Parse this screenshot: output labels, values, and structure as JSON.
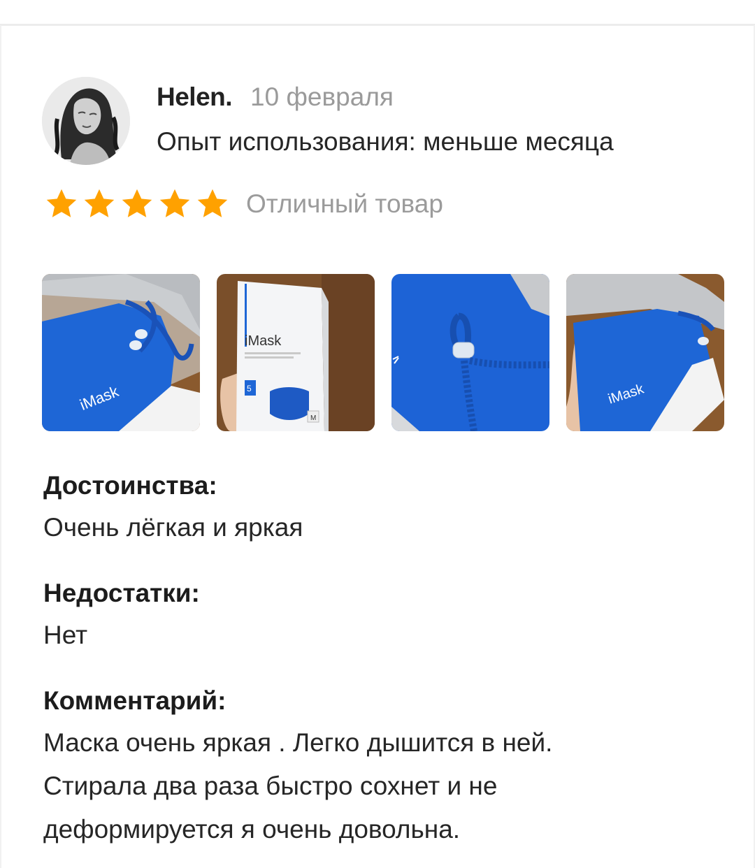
{
  "review": {
    "author": "Helen.",
    "date": "10 февраля",
    "usage": "Опыт использования: меньше месяца",
    "rating": 5,
    "rating_max": 5,
    "rating_label": "Отличный товар",
    "star_color": "#FFA100",
    "photos": [
      {
        "brand_text": "iMask"
      },
      {
        "brand_text": "iMask",
        "box_number": "5",
        "size_mark": "M"
      },
      {},
      {
        "brand_text": "iMask"
      }
    ],
    "pros_title": "Достоинства:",
    "pros_text": "Очень лёгкая и яркая",
    "cons_title": "Недостатки:",
    "cons_text": "Нет",
    "comment_title": "Комментарий:",
    "comment_lines": [
      "Маска  очень яркая . Легко дышится в ней.",
      "Стирала два раза быстро сохнет и не",
      "деформируется я очень довольна."
    ]
  }
}
